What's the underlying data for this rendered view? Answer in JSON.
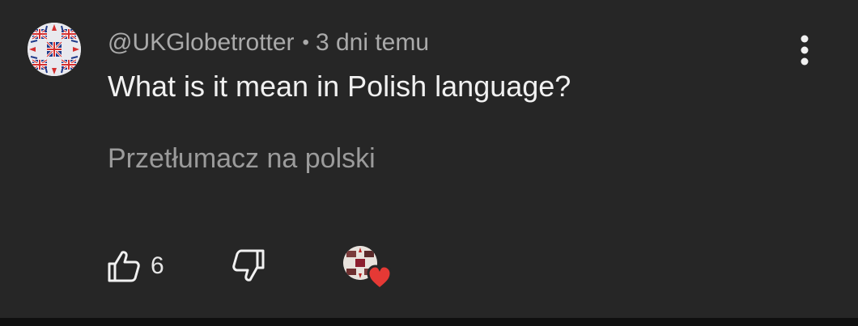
{
  "comment": {
    "author": "@UKGlobetrotter",
    "separator": "•",
    "timestamp": "3 dni temu",
    "text": "What is it mean in Polish language?",
    "translate_label": "Przetłumacz na polski"
  },
  "actions": {
    "like_count": "6",
    "like_icon": "thumb-up-outline",
    "dislike_icon": "thumb-down-outline",
    "more_icon": "vertical-dots",
    "creator_heart_icon": "heart-filled"
  },
  "colors": {
    "card_background": "#262626",
    "page_background": "#0f0f0f",
    "primary_text": "#f1f1f1",
    "secondary_text": "#aaaaaa",
    "heart": "#e53935"
  }
}
